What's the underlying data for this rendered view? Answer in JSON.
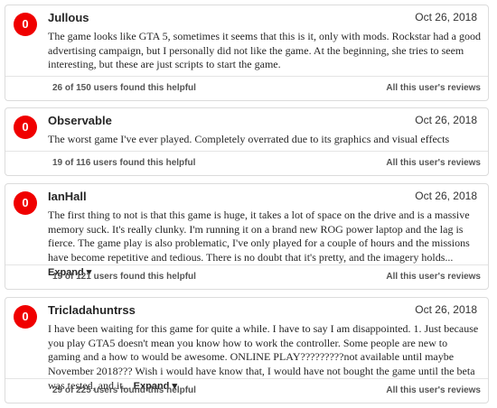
{
  "reviews": [
    {
      "score": "0",
      "username": "Jullous",
      "date": "Oct 26, 2018",
      "text": "The game looks like GTA 5, sometimes it seems that this is it, only with mods. Rockstar had a good advertising campaign, but I personally did not like the game. At the beginning, she tries to seem interesting, but these are just scripts to start the game.",
      "expand_label": "",
      "helpful": "26 of 150 users found this helpful",
      "all_reviews": "All this user's reviews"
    },
    {
      "score": "0",
      "username": "Observable",
      "date": "Oct 26, 2018",
      "text": "The worst game I've ever played. Completely overrated due to its graphics and visual effects",
      "expand_label": "",
      "helpful": "19 of 116 users found this helpful",
      "all_reviews": "All this user's reviews"
    },
    {
      "score": "0",
      "username": "IanHall",
      "date": "Oct 26, 2018",
      "text": "The first thing to not is that this game is huge, it takes a lot of space on the drive and is a massive memory suck. It's really clunky. I'm running it on a brand new ROG power laptop and the lag is fierce. The game play is also problematic, I've only played for a couple of hours and the missions have become repetitive and tedious. There is no doubt that it's pretty, and the imagery holds...",
      "expand_label": "Expand ▾",
      "helpful": "19 of 121 users found this helpful",
      "all_reviews": "All this user's reviews"
    },
    {
      "score": "0",
      "username": "Tricladahuntrss",
      "date": "Oct 26, 2018",
      "text": "I have been waiting for this game for quite a while. I have to say I am disappointed. 1. Just because you play GTA5 doesn't mean you know how to work the controller. Some people are new to gaming and a how to would be awesome. ONLINE PLAY?????????not available until maybe November 2018??? Wish i would have know that, I would have not bought the game until the beta was tested, and it...",
      "expand_label": "Expand ▾",
      "helpful": "29 of 225 users found this helpful",
      "all_reviews": "All this user's reviews"
    }
  ]
}
